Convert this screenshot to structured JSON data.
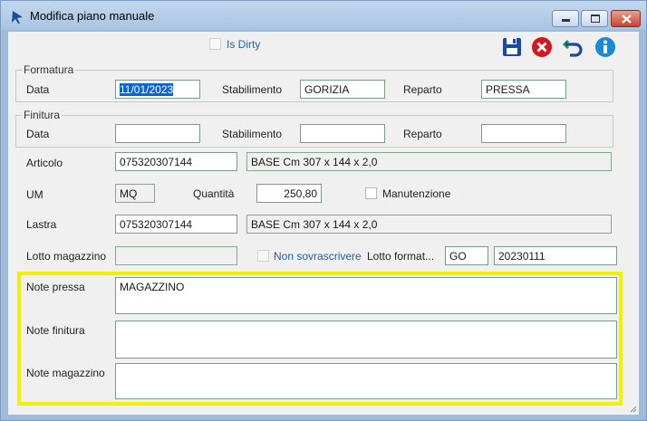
{
  "window": {
    "title": "Modifica piano manuale"
  },
  "toolbar": {
    "is_dirty_label": "Is Dirty",
    "save_icon": "save-icon",
    "cancel_icon": "cancel-icon",
    "undo_icon": "undo-icon",
    "info_icon": "info-icon"
  },
  "formatura": {
    "group_label": "Formatura",
    "data_label": "Data",
    "data_value": "11/01/2023",
    "stabilimento_label": "Stabilimento",
    "stabilimento_value": "GORIZIA",
    "reparto_label": "Reparto",
    "reparto_value": "PRESSA"
  },
  "finitura": {
    "group_label": "Finitura",
    "data_label": "Data",
    "data_value": "",
    "stabilimento_label": "Stabilimento",
    "stabilimento_value": "",
    "reparto_label": "Reparto",
    "reparto_value": ""
  },
  "articolo": {
    "label": "Articolo",
    "code": "075320307144",
    "description": "BASE Cm 307 x 144 x 2,0"
  },
  "um": {
    "label": "UM",
    "value": "MQ",
    "quantita_label": "Quantità",
    "quantita_value": "250,80",
    "manutenzione_label": "Manutenzione"
  },
  "lastra": {
    "label": "Lastra",
    "code": "075320307144",
    "description": "BASE Cm 307 x 144 x 2,0"
  },
  "lotto": {
    "magazzino_label": "Lotto magazzino",
    "magazzino_value": "",
    "non_sovrascrivere_label": "Non sovrascrivere",
    "formatura_label": "Lotto format...",
    "formatura_prefix": "GO",
    "formatura_value": "20230111"
  },
  "notes": {
    "pressa_label": "Note pressa",
    "pressa_value": "MAGAZZINO",
    "finitura_label": "Note finitura",
    "finitura_value": "",
    "magazzino_label": "Note magazzino",
    "magazzino_value": ""
  },
  "colors": {
    "highlight": "#f5ef00",
    "selection": "#0a64d2",
    "link_blue": "#1f5fa8"
  }
}
